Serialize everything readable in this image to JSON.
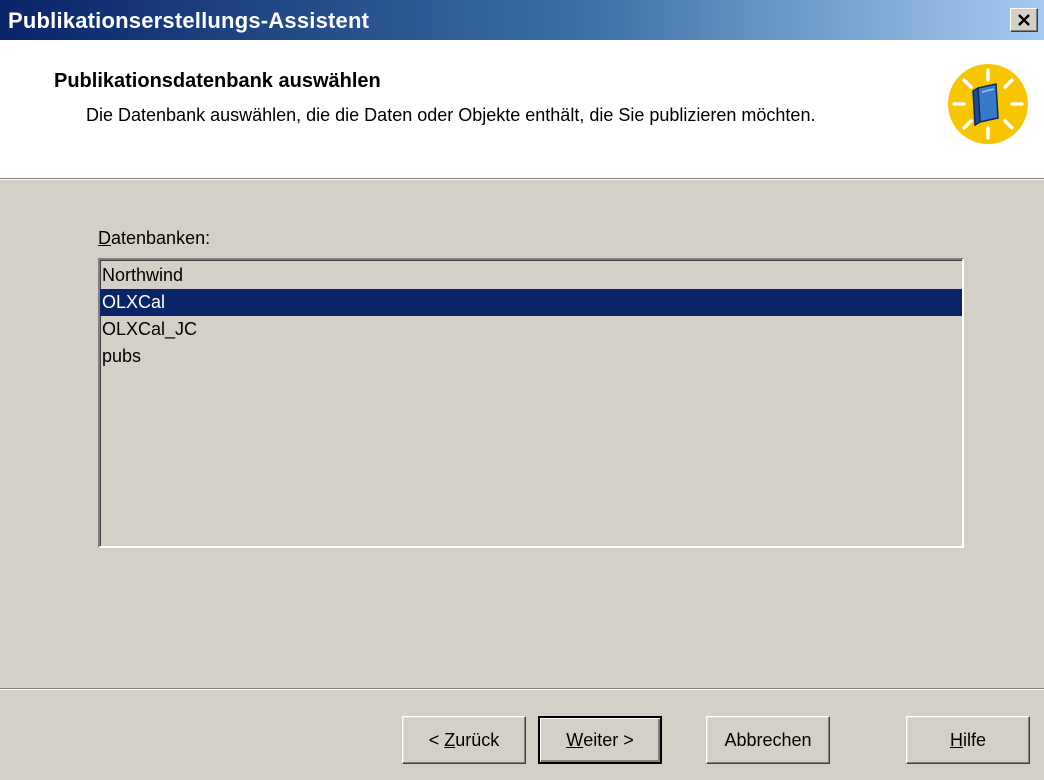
{
  "window": {
    "title": "Publikationserstellungs-Assistent",
    "close_symbol": "×"
  },
  "header": {
    "title": "Publikationsdatenbank auswählen",
    "description": "Die Datenbank auswählen, die die Daten oder Objekte enthält, die Sie publizieren möchten.",
    "icon": "publication-book-icon"
  },
  "databases": {
    "label_accel": "D",
    "label_rest": "atenbanken:",
    "items": [
      "Northwind",
      "OLXCal",
      "OLXCal_JC",
      "pubs"
    ],
    "selected": "OLXCal"
  },
  "buttons": {
    "back_prefix": "< ",
    "back_accel": "Z",
    "back_rest": "urück",
    "next_accel": "W",
    "next_rest": "eiter >",
    "cancel": "Abbrechen",
    "help_accel": "H",
    "help_rest": "ilfe"
  },
  "colors": {
    "title_gradient_start": "#0a246a",
    "title_gradient_end": "#a6caf0",
    "selection": "#0a246a",
    "face": "#d4d0c8",
    "icon_sun": "#f7c600",
    "icon_book": "#3a78c8"
  }
}
